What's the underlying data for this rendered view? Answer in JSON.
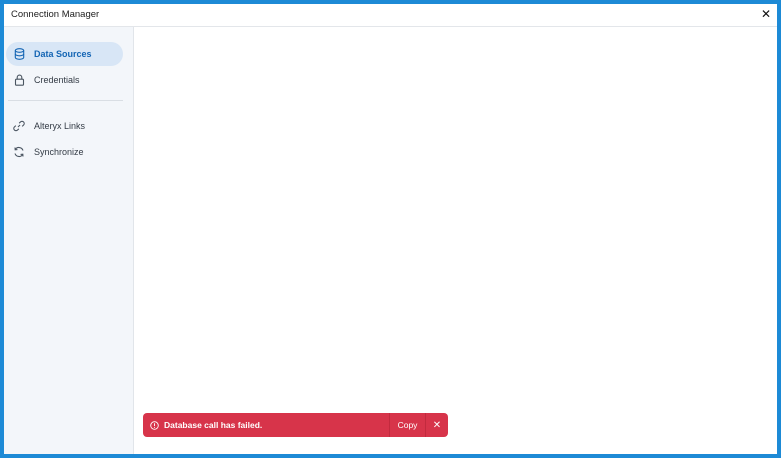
{
  "window": {
    "title": "Connection Manager",
    "close_symbol": "✕"
  },
  "sidebar": {
    "items": [
      {
        "label": "Data Sources",
        "icon": "database-icon",
        "active": true
      },
      {
        "label": "Credentials",
        "icon": "lock-icon",
        "active": false
      },
      {
        "label": "Alteryx Links",
        "icon": "link-icon",
        "active": false
      },
      {
        "label": "Synchronize",
        "icon": "sync-icon",
        "active": false
      }
    ]
  },
  "toast": {
    "message": "Database call has failed.",
    "copy_label": "Copy",
    "close_symbol": "✕",
    "icon": "alert-circle-icon",
    "color": "#d7344a"
  },
  "colors": {
    "window_border": "#1d8ad6",
    "sidebar_bg": "#f3f6fa",
    "active_item_bg": "#d8e6f6",
    "active_item_text": "#1465b4"
  }
}
